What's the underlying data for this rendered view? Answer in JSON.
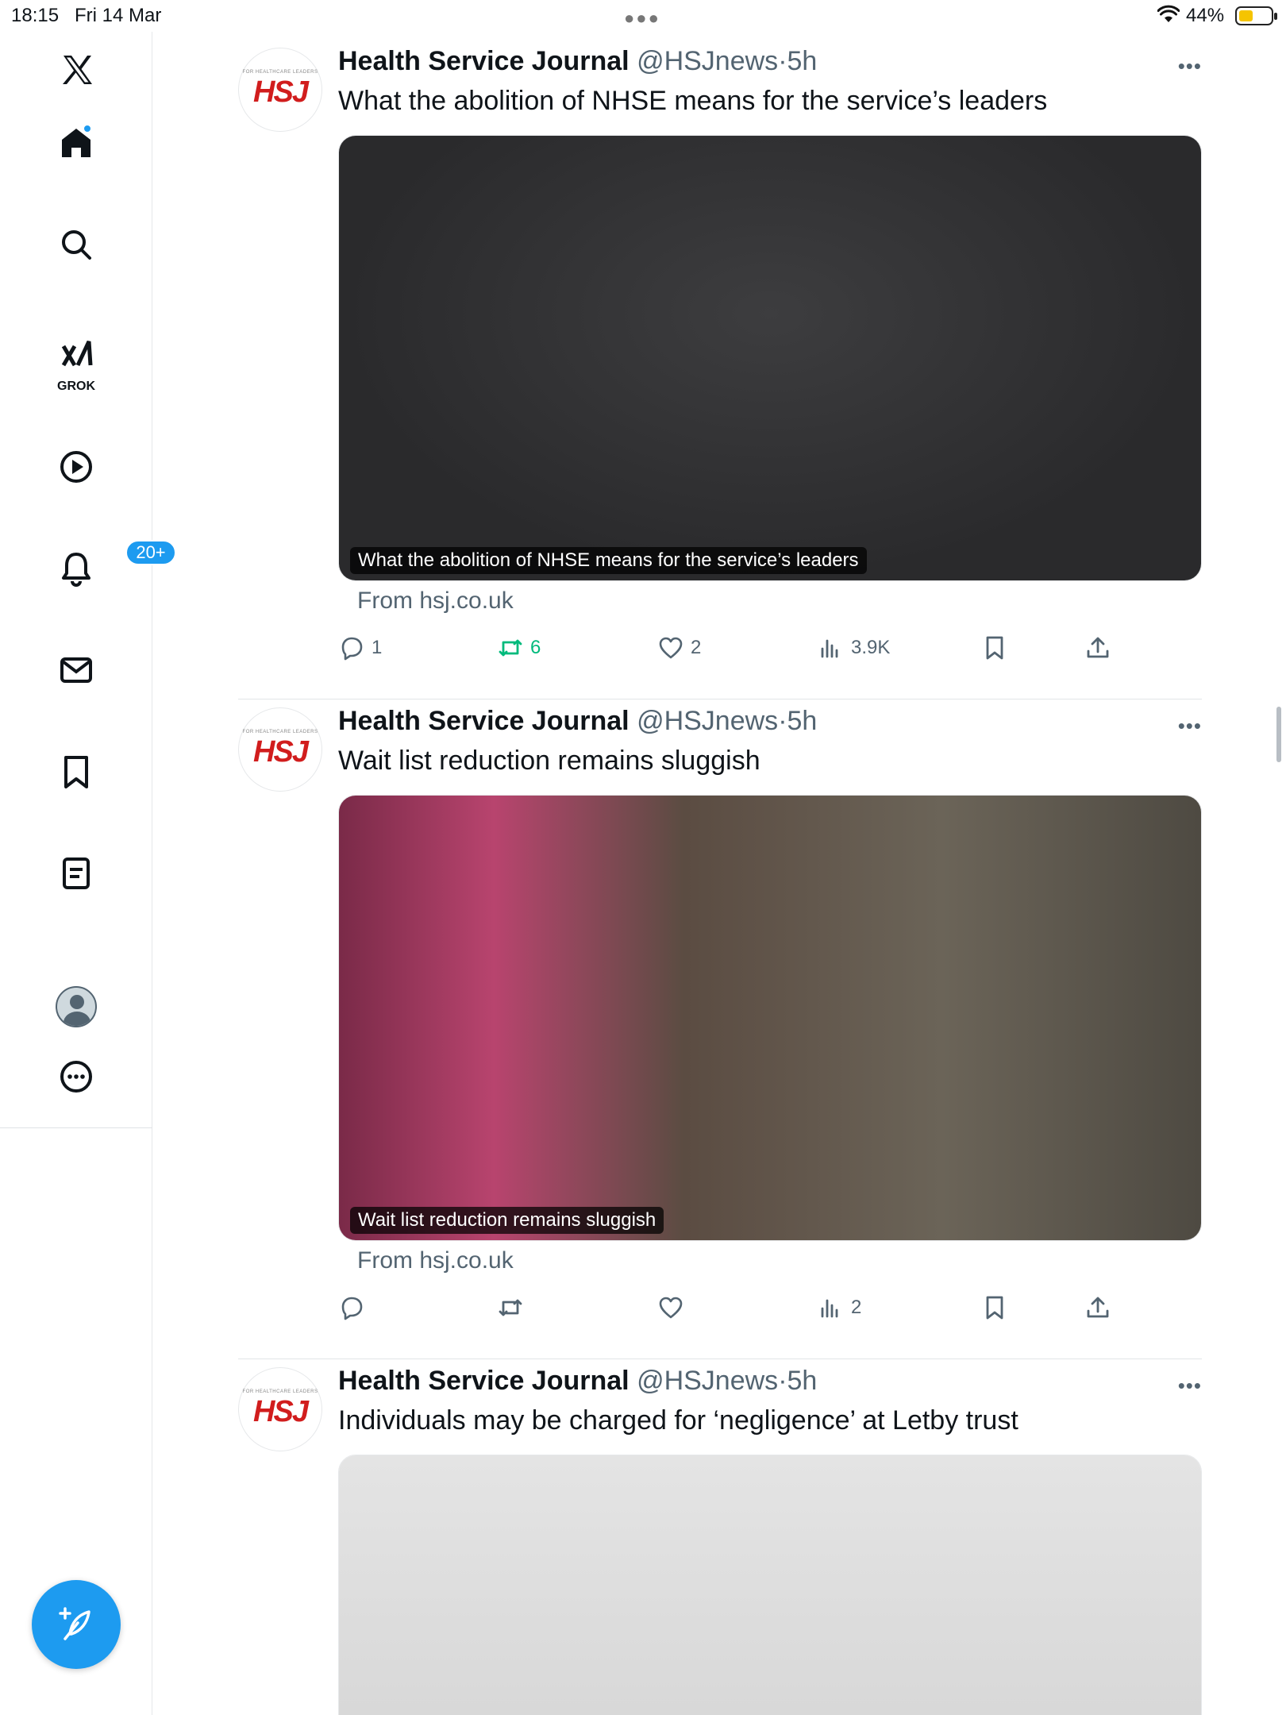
{
  "status_bar": {
    "time": "18:15",
    "date": "Fri 14 Mar",
    "battery": "44%"
  },
  "sidebar": {
    "items": [
      {
        "name": "x-logo-icon"
      },
      {
        "name": "home-icon",
        "has_new": true
      },
      {
        "name": "search-icon"
      },
      {
        "name": "grok-icon",
        "label": "GROK"
      },
      {
        "name": "video-icon"
      },
      {
        "name": "notifications-icon",
        "badge": "20+"
      },
      {
        "name": "messages-icon"
      },
      {
        "name": "bookmarks-icon"
      },
      {
        "name": "lists-icon"
      },
      {
        "name": "profile-avatar"
      },
      {
        "name": "more-icon"
      }
    ],
    "compose_icon": "feather-plus-icon",
    "accent_color": "#1d9bf0"
  },
  "tweets": [
    {
      "name": "Health Service Journal",
      "handle": "@HSJnews",
      "time": "5h",
      "avatar_logo": "HSJ",
      "avatar_tag": "FOR HEALTHCARE LEADERS",
      "text": "What the abolition of NHSE means for the service’s leaders",
      "card_caption": "What the abolition of NHSE means for the service’s leaders",
      "source": "From hsj.co.uk",
      "replies": "1",
      "reposts": "6",
      "likes": "2",
      "views": "3.9K",
      "reposted_by_me": true
    },
    {
      "name": "Health Service Journal",
      "handle": "@HSJnews",
      "time": "5h",
      "avatar_logo": "HSJ",
      "avatar_tag": "FOR HEALTHCARE LEADERS",
      "text": "Wait list reduction remains sluggish",
      "card_caption": "Wait list reduction remains sluggish",
      "source": "From hsj.co.uk",
      "replies": "",
      "reposts": "",
      "likes": "",
      "views": "2",
      "reposted_by_me": false
    },
    {
      "name": "Health Service Journal",
      "handle": "@HSJnews",
      "time": "5h",
      "avatar_logo": "HSJ",
      "avatar_tag": "FOR HEALTHCARE LEADERS",
      "text": "Individuals may be charged for ‘negligence’ at Letby trust"
    }
  ],
  "colors": {
    "text_primary": "#0f1419",
    "text_secondary": "#536471",
    "repost_active": "#00ba7c",
    "hsj_red": "#d11d1d"
  }
}
